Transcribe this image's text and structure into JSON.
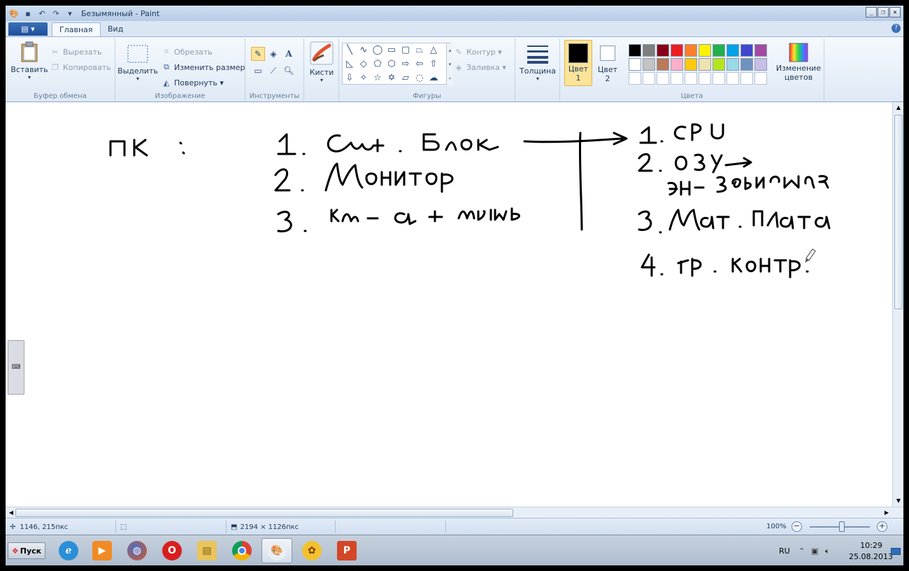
{
  "window": {
    "title": "Безымянный - Paint"
  },
  "tabs": {
    "app_menu": "▤ ▾",
    "home": "Главная",
    "view": "Вид"
  },
  "ribbon": {
    "clipboard": {
      "paste": "Вставить",
      "cut": "Вырезать",
      "copy": "Копировать",
      "label": "Буфер обмена"
    },
    "image": {
      "select": "Выделить",
      "crop": "Обрезать",
      "resize": "Изменить размер",
      "rotate": "Повернуть ▾",
      "label": "Изображение"
    },
    "tools": {
      "label": "Инструменты"
    },
    "brushes": {
      "label": "Кисти"
    },
    "shapes": {
      "outline": "Контур ▾",
      "fill": "Заливка ▾",
      "label": "Фигуры"
    },
    "thickness": {
      "label": "Толщина"
    },
    "colors": {
      "color1_label": "Цвет 1",
      "color2_label": "Цвет 2",
      "edit_colors": "Изменение цветов",
      "label": "Цвета",
      "color1_value": "#000000",
      "color2_value": "#ffffff",
      "palette_row1": [
        "#000000",
        "#7f7f7f",
        "#880015",
        "#ed1c24",
        "#ff7f27",
        "#fff200",
        "#22b14c",
        "#00a2e8",
        "#3f48cc",
        "#a349a4"
      ],
      "palette_row2": [
        "#ffffff",
        "#c3c3c3",
        "#b97a57",
        "#ffaec9",
        "#ffc90e",
        "#efe4b0",
        "#b5e61d",
        "#99d9ea",
        "#7092be",
        "#c8bfe7"
      ]
    }
  },
  "canvas_note": {
    "pc_label": "ПК :",
    "left_list": [
      "1. Сист. Блок",
      "2. Монитор",
      "3. Кл-а + мышь"
    ],
    "right_list": [
      "1. CPU",
      "2. ОЗУ →",
      "эн-зависимая",
      "3. Мат. плата",
      "4. гр. контр."
    ]
  },
  "status": {
    "cursor_pos": "1146, 215пкс",
    "canvas_size": "2194 × 1126пкс",
    "zoom": "100%"
  },
  "taskbar": {
    "start_label": "Пуск",
    "lang": "RU",
    "time": "10:29",
    "date": "25.08.2013"
  }
}
